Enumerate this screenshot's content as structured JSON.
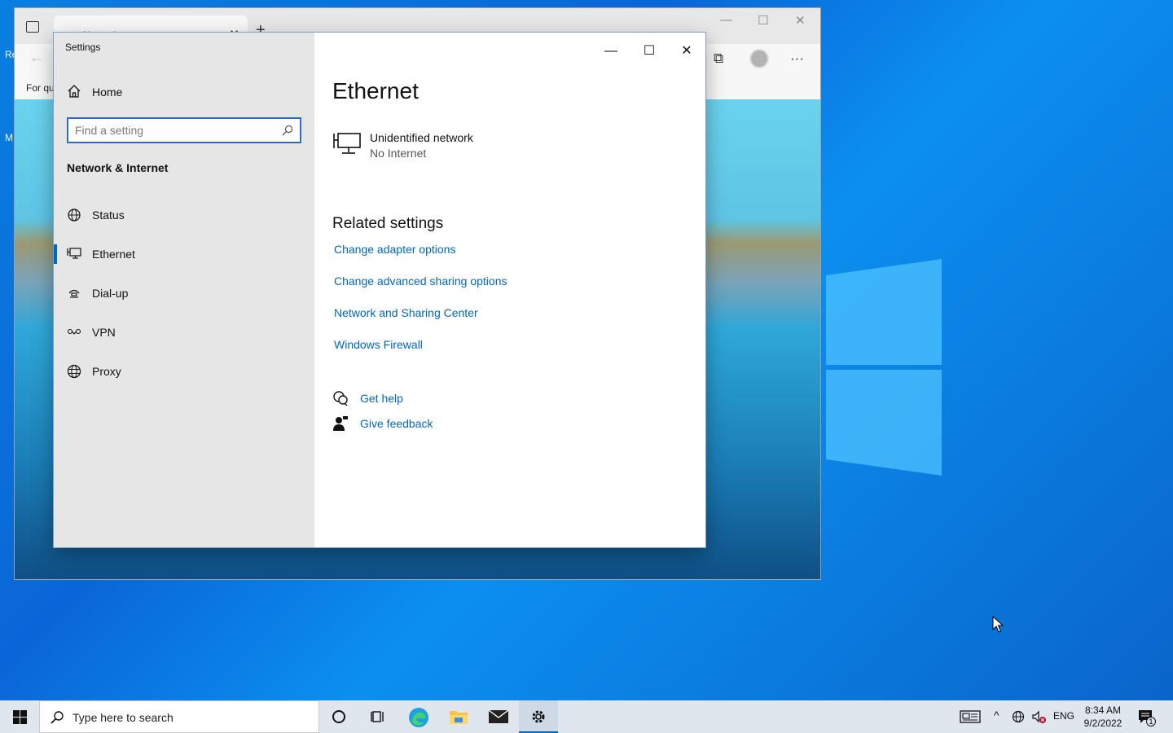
{
  "browser": {
    "tab_title": "New tab",
    "favorites_label": "For qu",
    "desktop_stub_1": "Re",
    "desktop_stub_2": "M"
  },
  "settings": {
    "app_title": "Settings",
    "home_label": "Home",
    "search_placeholder": "Find a setting",
    "section_title": "Network & Internet",
    "nav_items": [
      {
        "label": "Status",
        "icon": "globe-network-icon"
      },
      {
        "label": "Ethernet",
        "icon": "ethernet-icon",
        "active": true
      },
      {
        "label": "Dial-up",
        "icon": "dialup-icon"
      },
      {
        "label": "VPN",
        "icon": "vpn-icon"
      },
      {
        "label": "Proxy",
        "icon": "globe-icon"
      }
    ],
    "page_title": "Ethernet",
    "network": {
      "name": "Unidentified network",
      "status": "No Internet"
    },
    "related_title": "Related settings",
    "related_links": [
      "Change adapter options",
      "Change advanced sharing options",
      "Network and Sharing Center",
      "Windows Firewall"
    ],
    "help_label": "Get help",
    "feedback_label": "Give feedback",
    "accent_color": "#0067c0"
  },
  "taskbar": {
    "search_placeholder": "Type here to search",
    "language": "ENG",
    "time": "8:34 AM",
    "date": "9/2/2022",
    "notification_count": "1"
  }
}
